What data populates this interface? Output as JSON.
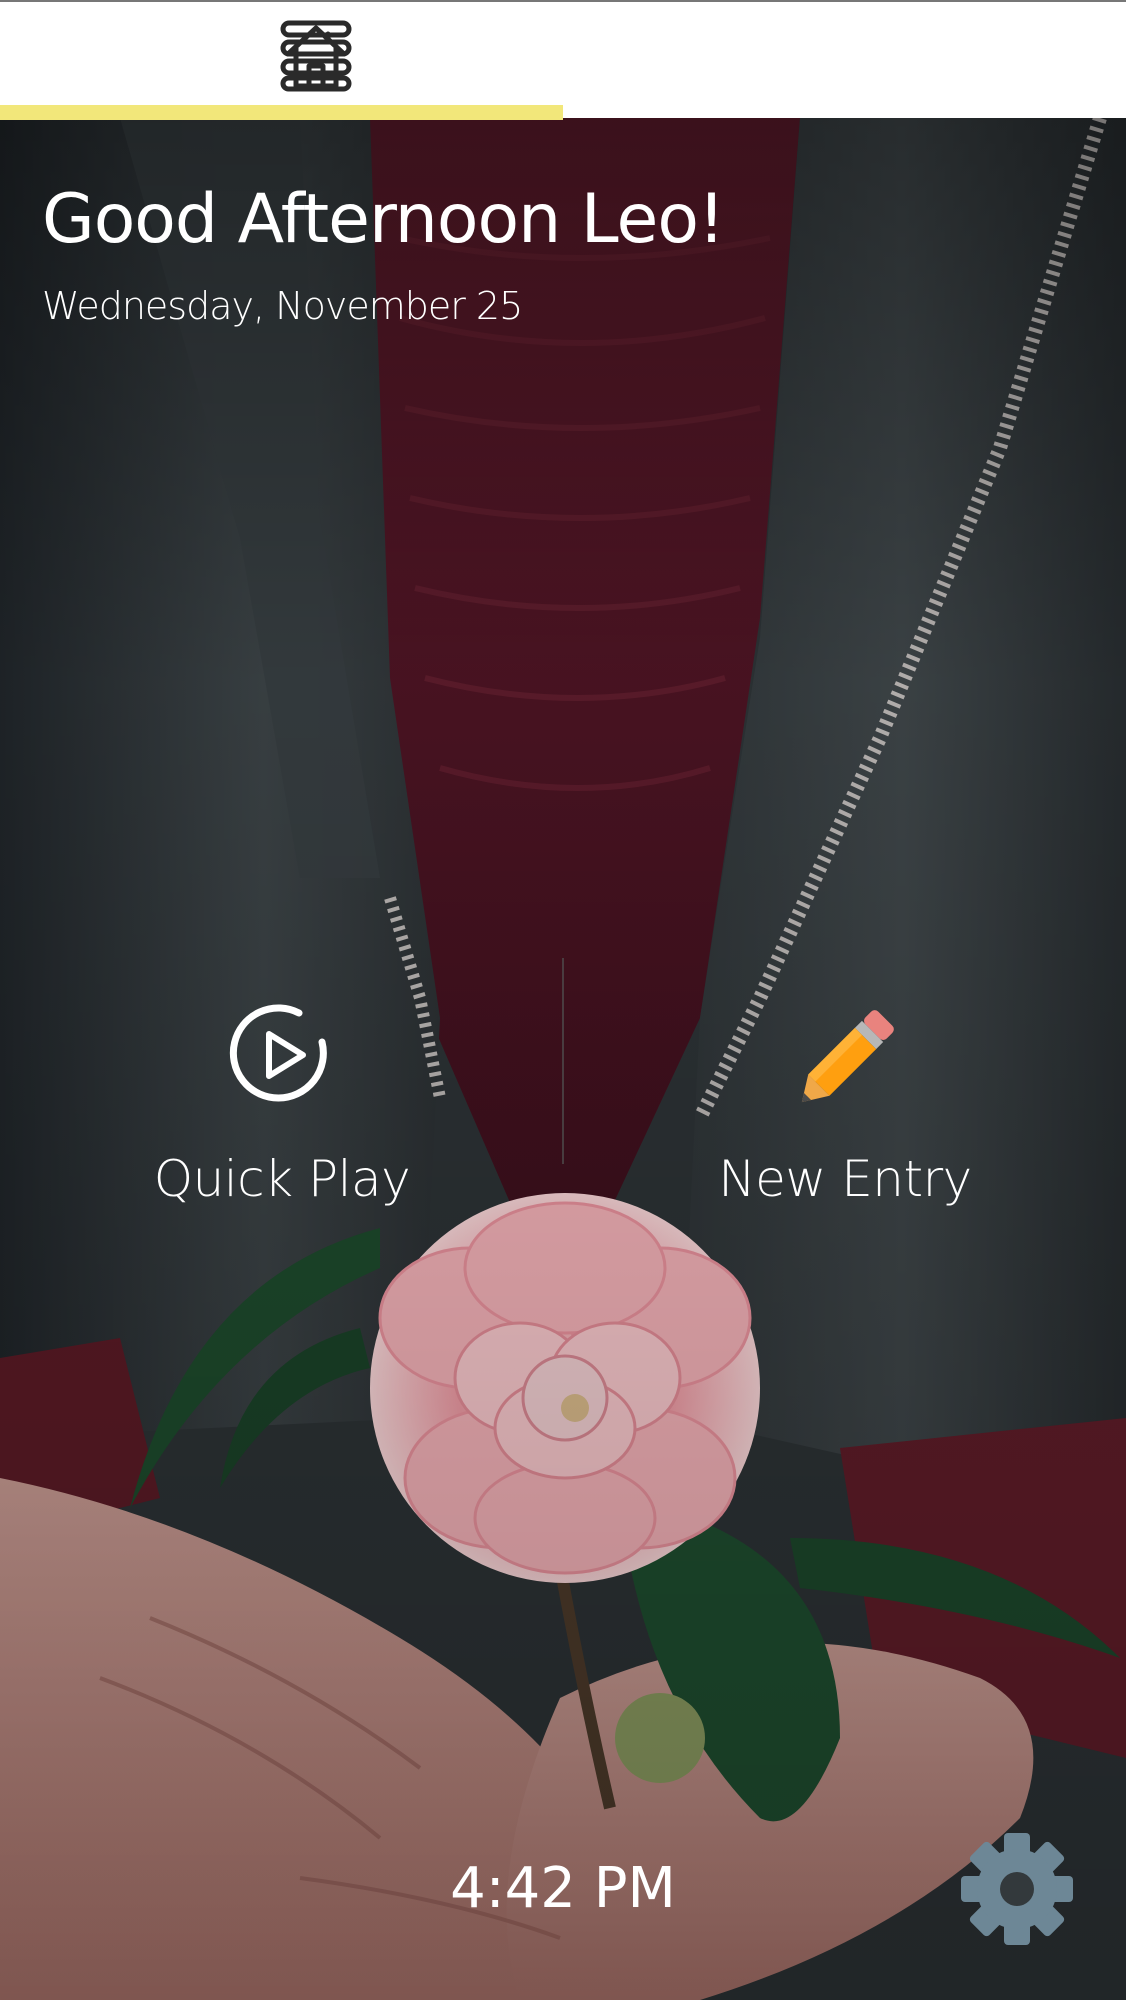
{
  "nav": {
    "home_icon": "home-icon",
    "menu_icon": "menu-icon",
    "active_tab": "home",
    "indicator_color": "#f2e77a"
  },
  "greeting": {
    "title": "Good Afternoon Leo!",
    "date": "Wednesday, November 25"
  },
  "actions": {
    "quick_play": {
      "label": "Quick Play",
      "icon": "play-circle-icon"
    },
    "new_entry": {
      "label": "New Entry",
      "icon": "pencil-icon"
    }
  },
  "footer": {
    "time": "4:42 PM",
    "settings_icon": "gear-icon"
  }
}
